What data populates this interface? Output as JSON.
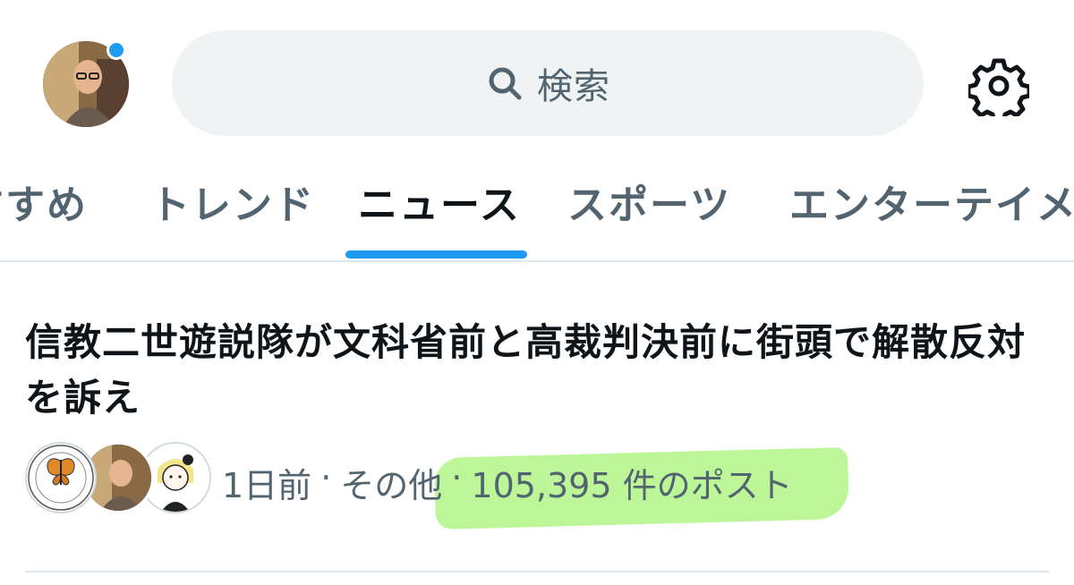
{
  "header": {
    "search_label": "検索",
    "search_icon": "search-icon",
    "settings_icon": "gear-icon"
  },
  "tabs": [
    {
      "label": "すすめ",
      "active": false
    },
    {
      "label": "トレンド",
      "active": false
    },
    {
      "label": "ニュース",
      "active": true
    },
    {
      "label": "スポーツ",
      "active": false
    },
    {
      "label": "エンターテイメント",
      "active": false
    }
  ],
  "news": {
    "title": "信教二世遊説隊が文科省前と高裁判決前に街頭で解散反対を訴え",
    "time": "1日前",
    "separator": "·",
    "category": "その他",
    "post_count": "105,395 件のポスト",
    "highlight_color": "#b5f58d"
  },
  "colors": {
    "accent": "#1d9bf0",
    "text_primary": "#0f1419",
    "text_secondary": "#536471",
    "search_bg": "#eff3f4"
  }
}
